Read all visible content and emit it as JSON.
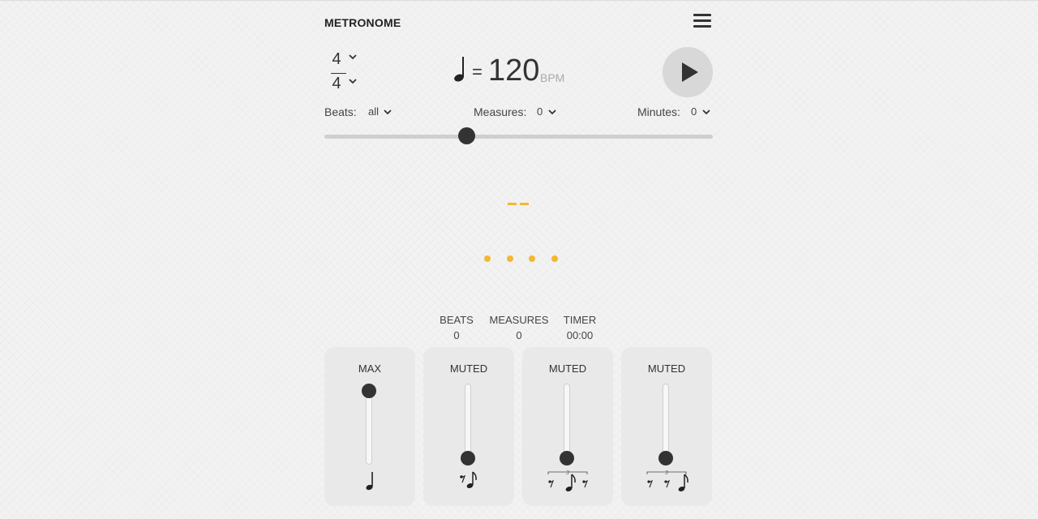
{
  "app": {
    "title": "METRONOME"
  },
  "time_signature": {
    "numerator": "4",
    "denominator": "4"
  },
  "tempo": {
    "note_icon": "quarter-note-icon",
    "equals": "=",
    "bpm": "120",
    "unit": "BPM"
  },
  "options": {
    "beats_label": "Beats:",
    "beats_value": "all",
    "measures_label": "Measures:",
    "measures_value": "0",
    "minutes_label": "Minutes:",
    "minutes_value": "0"
  },
  "tempo_slider": {
    "fraction": 0.365
  },
  "visual": {
    "beat_count": 4,
    "accent_color": "#f5b731"
  },
  "stats": [
    {
      "label": "BEATS",
      "value": "0"
    },
    {
      "label": "MEASURES",
      "value": "0"
    },
    {
      "label": "TIMER",
      "value": "00:00"
    }
  ],
  "subdivisions": [
    {
      "label": "MAX",
      "level": 1.0,
      "pattern_icon": "quarter-note-icon"
    },
    {
      "label": "MUTED",
      "level": 0.0,
      "pattern_icon": "eighth-rest-eighth-note-icon"
    },
    {
      "label": "MUTED",
      "level": 0.0,
      "pattern_icon": "triplet-rest-note-rest-icon"
    },
    {
      "label": "MUTED",
      "level": 0.0,
      "pattern_icon": "triplet-rest-rest-note-icon"
    }
  ]
}
